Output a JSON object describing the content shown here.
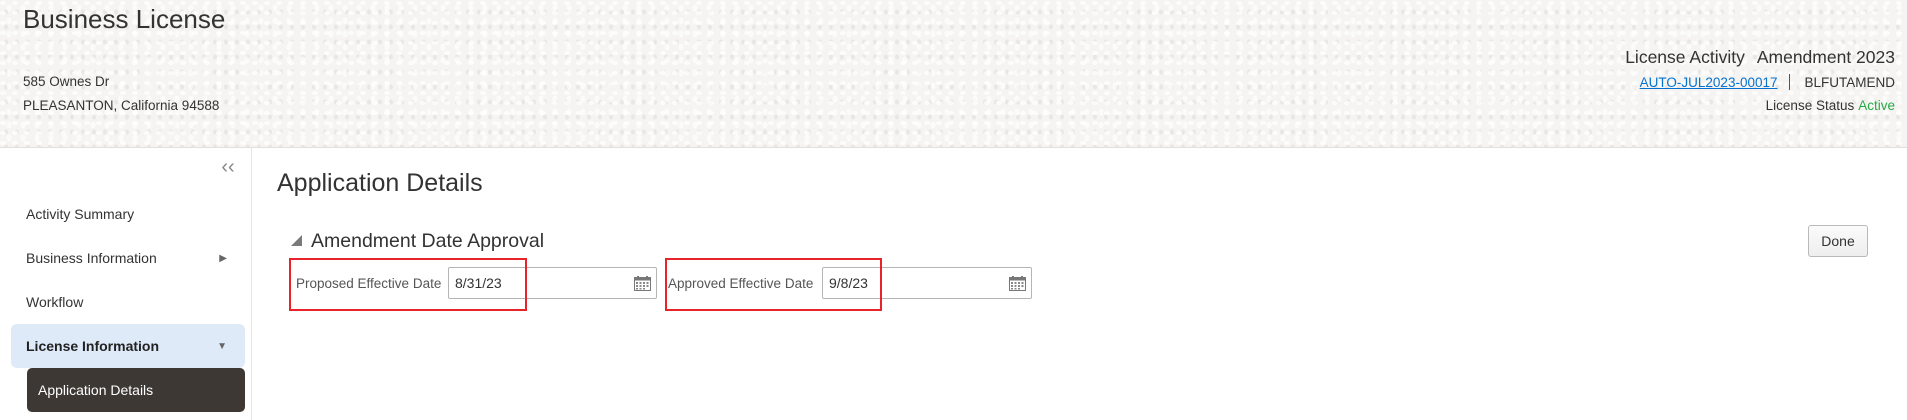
{
  "header": {
    "app_title": "Business License",
    "address_line1": "585 Ownes Dr",
    "address_line2": "PLEASANTON, California 94588",
    "activity_label": "License Activity",
    "activity_type": "Amendment 2023",
    "reference_number": "AUTO-JUL2023-00017",
    "reference_code": "BLFUTAMEND",
    "status_label": "License Status",
    "status_value": "Active",
    "status_color": "#28a745",
    "link_color": "#0572ce"
  },
  "sidebar": {
    "collapse_icon": "double-chevron-left-icon",
    "items": [
      {
        "label": "Activity Summary"
      },
      {
        "label": "Business Information",
        "icon": "chevron-right-icon"
      },
      {
        "label": "Workflow"
      },
      {
        "label": "License Information",
        "icon": "chevron-down-icon",
        "expanded": true
      },
      {
        "label": "Application Details",
        "selected": true
      }
    ]
  },
  "main": {
    "page_title": "Application Details",
    "section_title": "Amendment Date Approval",
    "done_label": "Done",
    "fields": [
      {
        "label": "Proposed Effective Date",
        "value": "8/31/23",
        "icon": "calendar-icon"
      },
      {
        "label": "Approved Effective Date",
        "value": "9/8/23",
        "icon": "calendar-icon"
      }
    ],
    "highlight_color": "#e8232a"
  }
}
